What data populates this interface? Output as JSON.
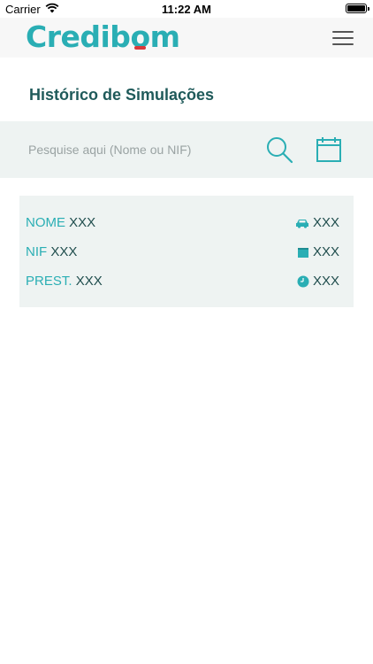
{
  "status_bar": {
    "carrier": "Carrier",
    "time": "11:22 AM"
  },
  "header": {
    "logo_main": "Credib",
    "logo_accent": "o",
    "logo_tail": "m",
    "menu_icon": "hamburger-icon"
  },
  "page": {
    "title": "Histórico de Simulações"
  },
  "search": {
    "placeholder": "Pesquise aqui (Nome ou NIF)",
    "value": "",
    "search_icon": "search-icon",
    "calendar_icon": "calendar-icon"
  },
  "simulation_card": {
    "rows": [
      {
        "label": "NOME",
        "value": "XXX",
        "right_icon": "car-icon",
        "right_value": "XXX"
      },
      {
        "label": "NIF",
        "value": "XXX",
        "right_icon": "calendar-icon",
        "right_value": "XXX"
      },
      {
        "label": "PREST.",
        "value": "XXX",
        "right_icon": "clock-icon",
        "right_value": "XXX"
      }
    ]
  },
  "colors": {
    "brand_teal": "#2aaeb4",
    "title_dark_teal": "#1f5a5a",
    "logo_red": "#d9383a",
    "panel_bg": "#eef3f2"
  }
}
